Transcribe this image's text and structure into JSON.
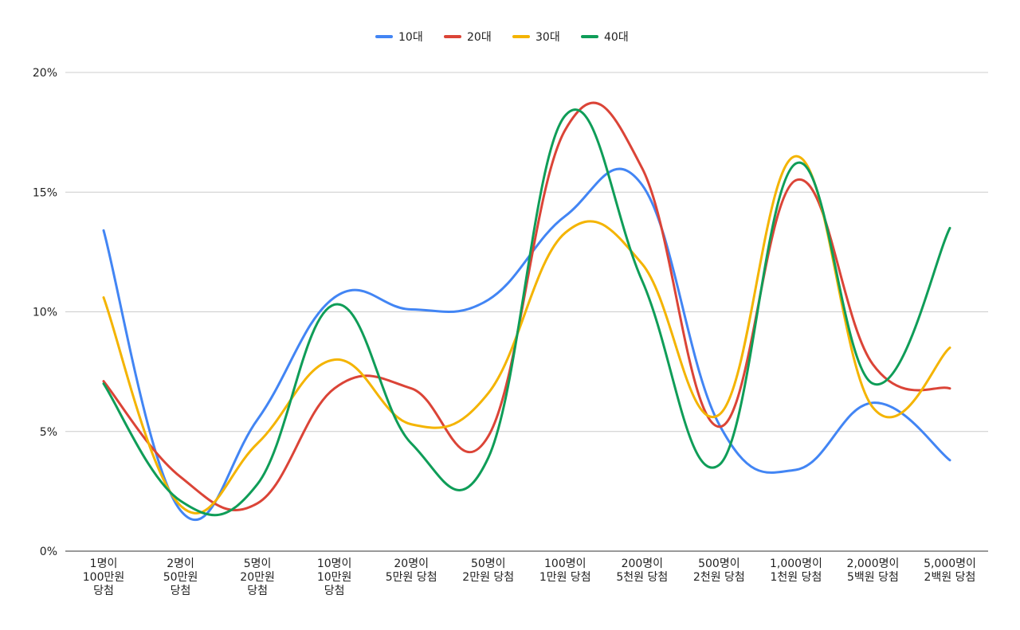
{
  "chart_data": {
    "type": "line",
    "smooth": true,
    "categories": [
      [
        "1명이",
        "100만원",
        "당첨"
      ],
      [
        "2명이",
        "50만원",
        "당첨"
      ],
      [
        "5명이",
        "20만원",
        "당첨"
      ],
      [
        "10명이",
        "10만원",
        "당첨"
      ],
      [
        "20명이",
        "5만원 당첨"
      ],
      [
        "50명이",
        "2만원 당첨"
      ],
      [
        "100명이",
        "1만원 당첨"
      ],
      [
        "200명이",
        "5천원 당첨"
      ],
      [
        "500명이",
        "2천원 당첨"
      ],
      [
        "1,000명이",
        "1천원 당첨"
      ],
      [
        "2,000명이",
        "5백원 당첨"
      ],
      [
        "5,000명이",
        "2백원 당첨"
      ]
    ],
    "series": [
      {
        "name": "10대",
        "color": "#4285F4",
        "values": [
          13.4,
          1.7,
          5.5,
          10.6,
          10.1,
          10.5,
          14.0,
          15.3,
          5.3,
          3.4,
          6.2,
          3.8
        ]
      },
      {
        "name": "20대",
        "color": "#DB4437",
        "values": [
          7.1,
          3.1,
          2.0,
          6.8,
          6.8,
          4.8,
          17.6,
          16.0,
          5.2,
          15.5,
          7.8,
          6.8
        ]
      },
      {
        "name": "30대",
        "color": "#F4B400",
        "values": [
          10.6,
          1.9,
          4.5,
          8.0,
          5.3,
          6.6,
          13.3,
          12.0,
          5.7,
          16.5,
          6.0,
          8.5
        ]
      },
      {
        "name": "40대",
        "color": "#0F9D58",
        "values": [
          7.0,
          2.1,
          2.8,
          10.3,
          4.5,
          3.9,
          18.2,
          11.3,
          3.6,
          16.2,
          7.0,
          13.5
        ]
      }
    ],
    "ylim": [
      0,
      20
    ],
    "yticks": [
      0,
      5,
      10,
      15,
      20
    ],
    "ytick_labels": [
      "0%",
      "5%",
      "10%",
      "15%",
      "20%"
    ],
    "legend_position": "top-center",
    "grid": true,
    "title": "",
    "xlabel": "",
    "ylabel": ""
  }
}
